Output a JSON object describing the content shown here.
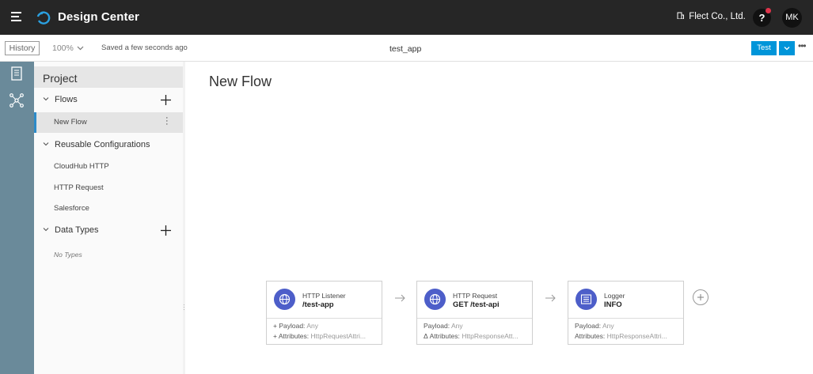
{
  "app": {
    "title": "Design Center",
    "org": "Flect Co., Ltd.",
    "help_glyph": "?",
    "avatar_initials": "MK"
  },
  "toolbar": {
    "history_label": "History",
    "zoom_value": "100%",
    "save_status": "Saved a few seconds ago",
    "project_name": "test_app",
    "test_label": "Test",
    "more_glyph": "•••"
  },
  "panel": {
    "title": "Project",
    "flows_label": "Flows",
    "flows": [
      {
        "label": "New Flow"
      }
    ],
    "reusable_label": "Reusable Configurations",
    "reusable": [
      {
        "label": "CloudHub HTTP"
      },
      {
        "label": "HTTP Request"
      },
      {
        "label": "Salesforce"
      }
    ],
    "data_types_label": "Data Types",
    "no_types_label": "No Types"
  },
  "canvas": {
    "flow_title": "New Flow",
    "nodes": [
      {
        "name": "HTTP Listener",
        "detail": "/test-app",
        "payload_prefix": "+",
        "payload_label": "Payload:",
        "payload_value": "Any",
        "attr_prefix": "+",
        "attr_label": "Attributes:",
        "attr_value": "HttpRequestAttri..."
      },
      {
        "name": "HTTP Request",
        "detail": "GET /test-api",
        "payload_prefix": "",
        "payload_label": "Payload:",
        "payload_value": "Any",
        "attr_prefix": "Δ",
        "attr_label": "Attributes:",
        "attr_value": "HttpResponseAtt..."
      },
      {
        "name": "Logger",
        "detail": "INFO",
        "payload_prefix": "",
        "payload_label": "Payload:",
        "payload_value": "Any",
        "attr_prefix": "",
        "attr_label": "Attributes:",
        "attr_value": "HttpResponseAttri..."
      }
    ]
  },
  "colors": {
    "topbar": "#262626",
    "accent": "#0095d9",
    "rail": "#6a8a9a",
    "node_icon": "#4d5ec9",
    "notification": "#e0344b"
  },
  "icons": [
    "hamburger-icon",
    "cloud-logo-icon",
    "building-icon",
    "chevron-down-icon",
    "document-icon",
    "flow-network-icon",
    "plus-icon",
    "kebab-icon",
    "globe-icon",
    "logger-icon",
    "arrow-right-icon",
    "add-circle-icon"
  ]
}
